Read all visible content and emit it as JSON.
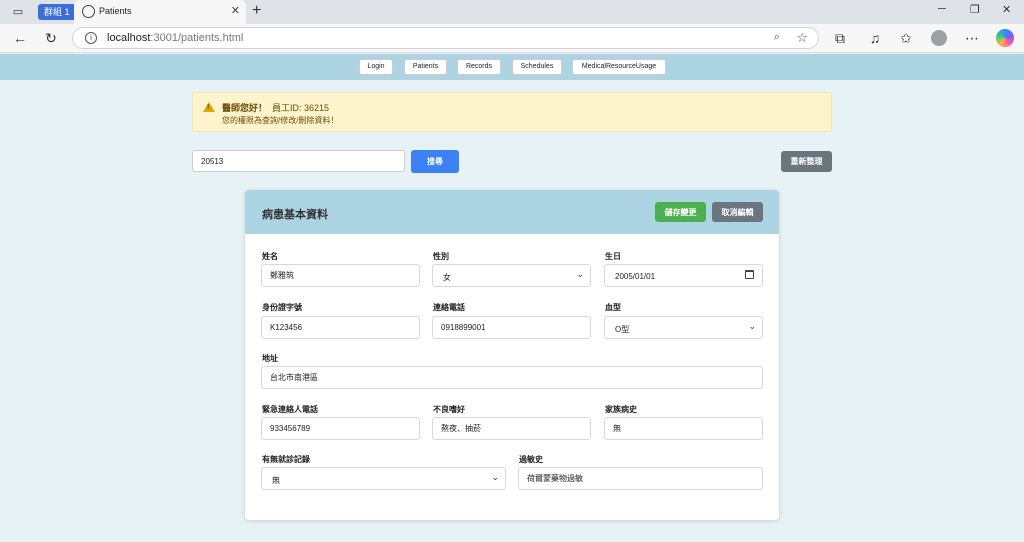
{
  "browser": {
    "group_label": "群組 1",
    "tab_title": "Patients",
    "url_host": "localhost",
    "url_rest": ":3001/patients.html"
  },
  "nav": {
    "items": [
      {
        "label": "Login"
      },
      {
        "label": "Patients"
      },
      {
        "label": "Records"
      },
      {
        "label": "Schedules"
      },
      {
        "label": "MedicalResourceUsage"
      }
    ]
  },
  "alert": {
    "greeting": "醫師您好！",
    "employee_id": "員工ID: 36215",
    "permission": "您的權限為查詢/修改/刪除資料！"
  },
  "search": {
    "value": "20513",
    "button": "搜尋",
    "reset": "重新整理"
  },
  "card": {
    "title": "病患基本資料",
    "save": "儲存變更",
    "cancel": "取消編輯"
  },
  "form": {
    "name": {
      "label": "姓名",
      "value": "鄭雅筑"
    },
    "gender": {
      "label": "性別",
      "value": "女"
    },
    "birthday": {
      "label": "生日",
      "value": "2005/01/01"
    },
    "id_number": {
      "label": "身份證字號",
      "value": "K123456"
    },
    "phone": {
      "label": "連絡電話",
      "value": "0918899001"
    },
    "blood_type": {
      "label": "血型",
      "value": "O型"
    },
    "address": {
      "label": "地址",
      "value": "台北市南港區"
    },
    "emergency_phone": {
      "label": "緊急連絡人電話",
      "value": "933456789"
    },
    "habits": {
      "label": "不良嗜好",
      "value": "熬夜、抽菸"
    },
    "family_history": {
      "label": "家族病史",
      "value": "無"
    },
    "visit_record": {
      "label": "有無就診記錄",
      "value": "無"
    },
    "allergy": {
      "label": "過敏史",
      "value": "荷爾蒙藥物過敏"
    }
  },
  "colors": {
    "nav_bg": "#add4e2",
    "page_bg": "#e6f2f5",
    "primary": "#3b82f6",
    "success": "#4caf50",
    "secondary": "#6c757d",
    "alert_bg": "#fdf3cd"
  }
}
